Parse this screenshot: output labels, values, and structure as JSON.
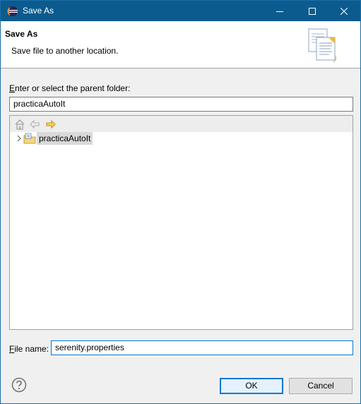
{
  "window": {
    "title": "Save As"
  },
  "banner": {
    "heading": "Save As",
    "description": "Save file to another location."
  },
  "folder": {
    "label_mnemonic": "E",
    "label_rest": "nter or select the parent folder:",
    "value": "practicaAutoIt"
  },
  "tree": {
    "items": [
      {
        "label": "practicaAutoIt",
        "expanded": false,
        "selected": true
      }
    ]
  },
  "filename": {
    "label_mnemonic": "F",
    "label_rest": "ile name:",
    "value": "serenity.properties"
  },
  "buttons": {
    "ok": "OK",
    "cancel": "Cancel"
  },
  "colors": {
    "titlebar": "#0c5b8e",
    "focus": "#0078d7",
    "tree_selection": "#d9d9d9"
  }
}
